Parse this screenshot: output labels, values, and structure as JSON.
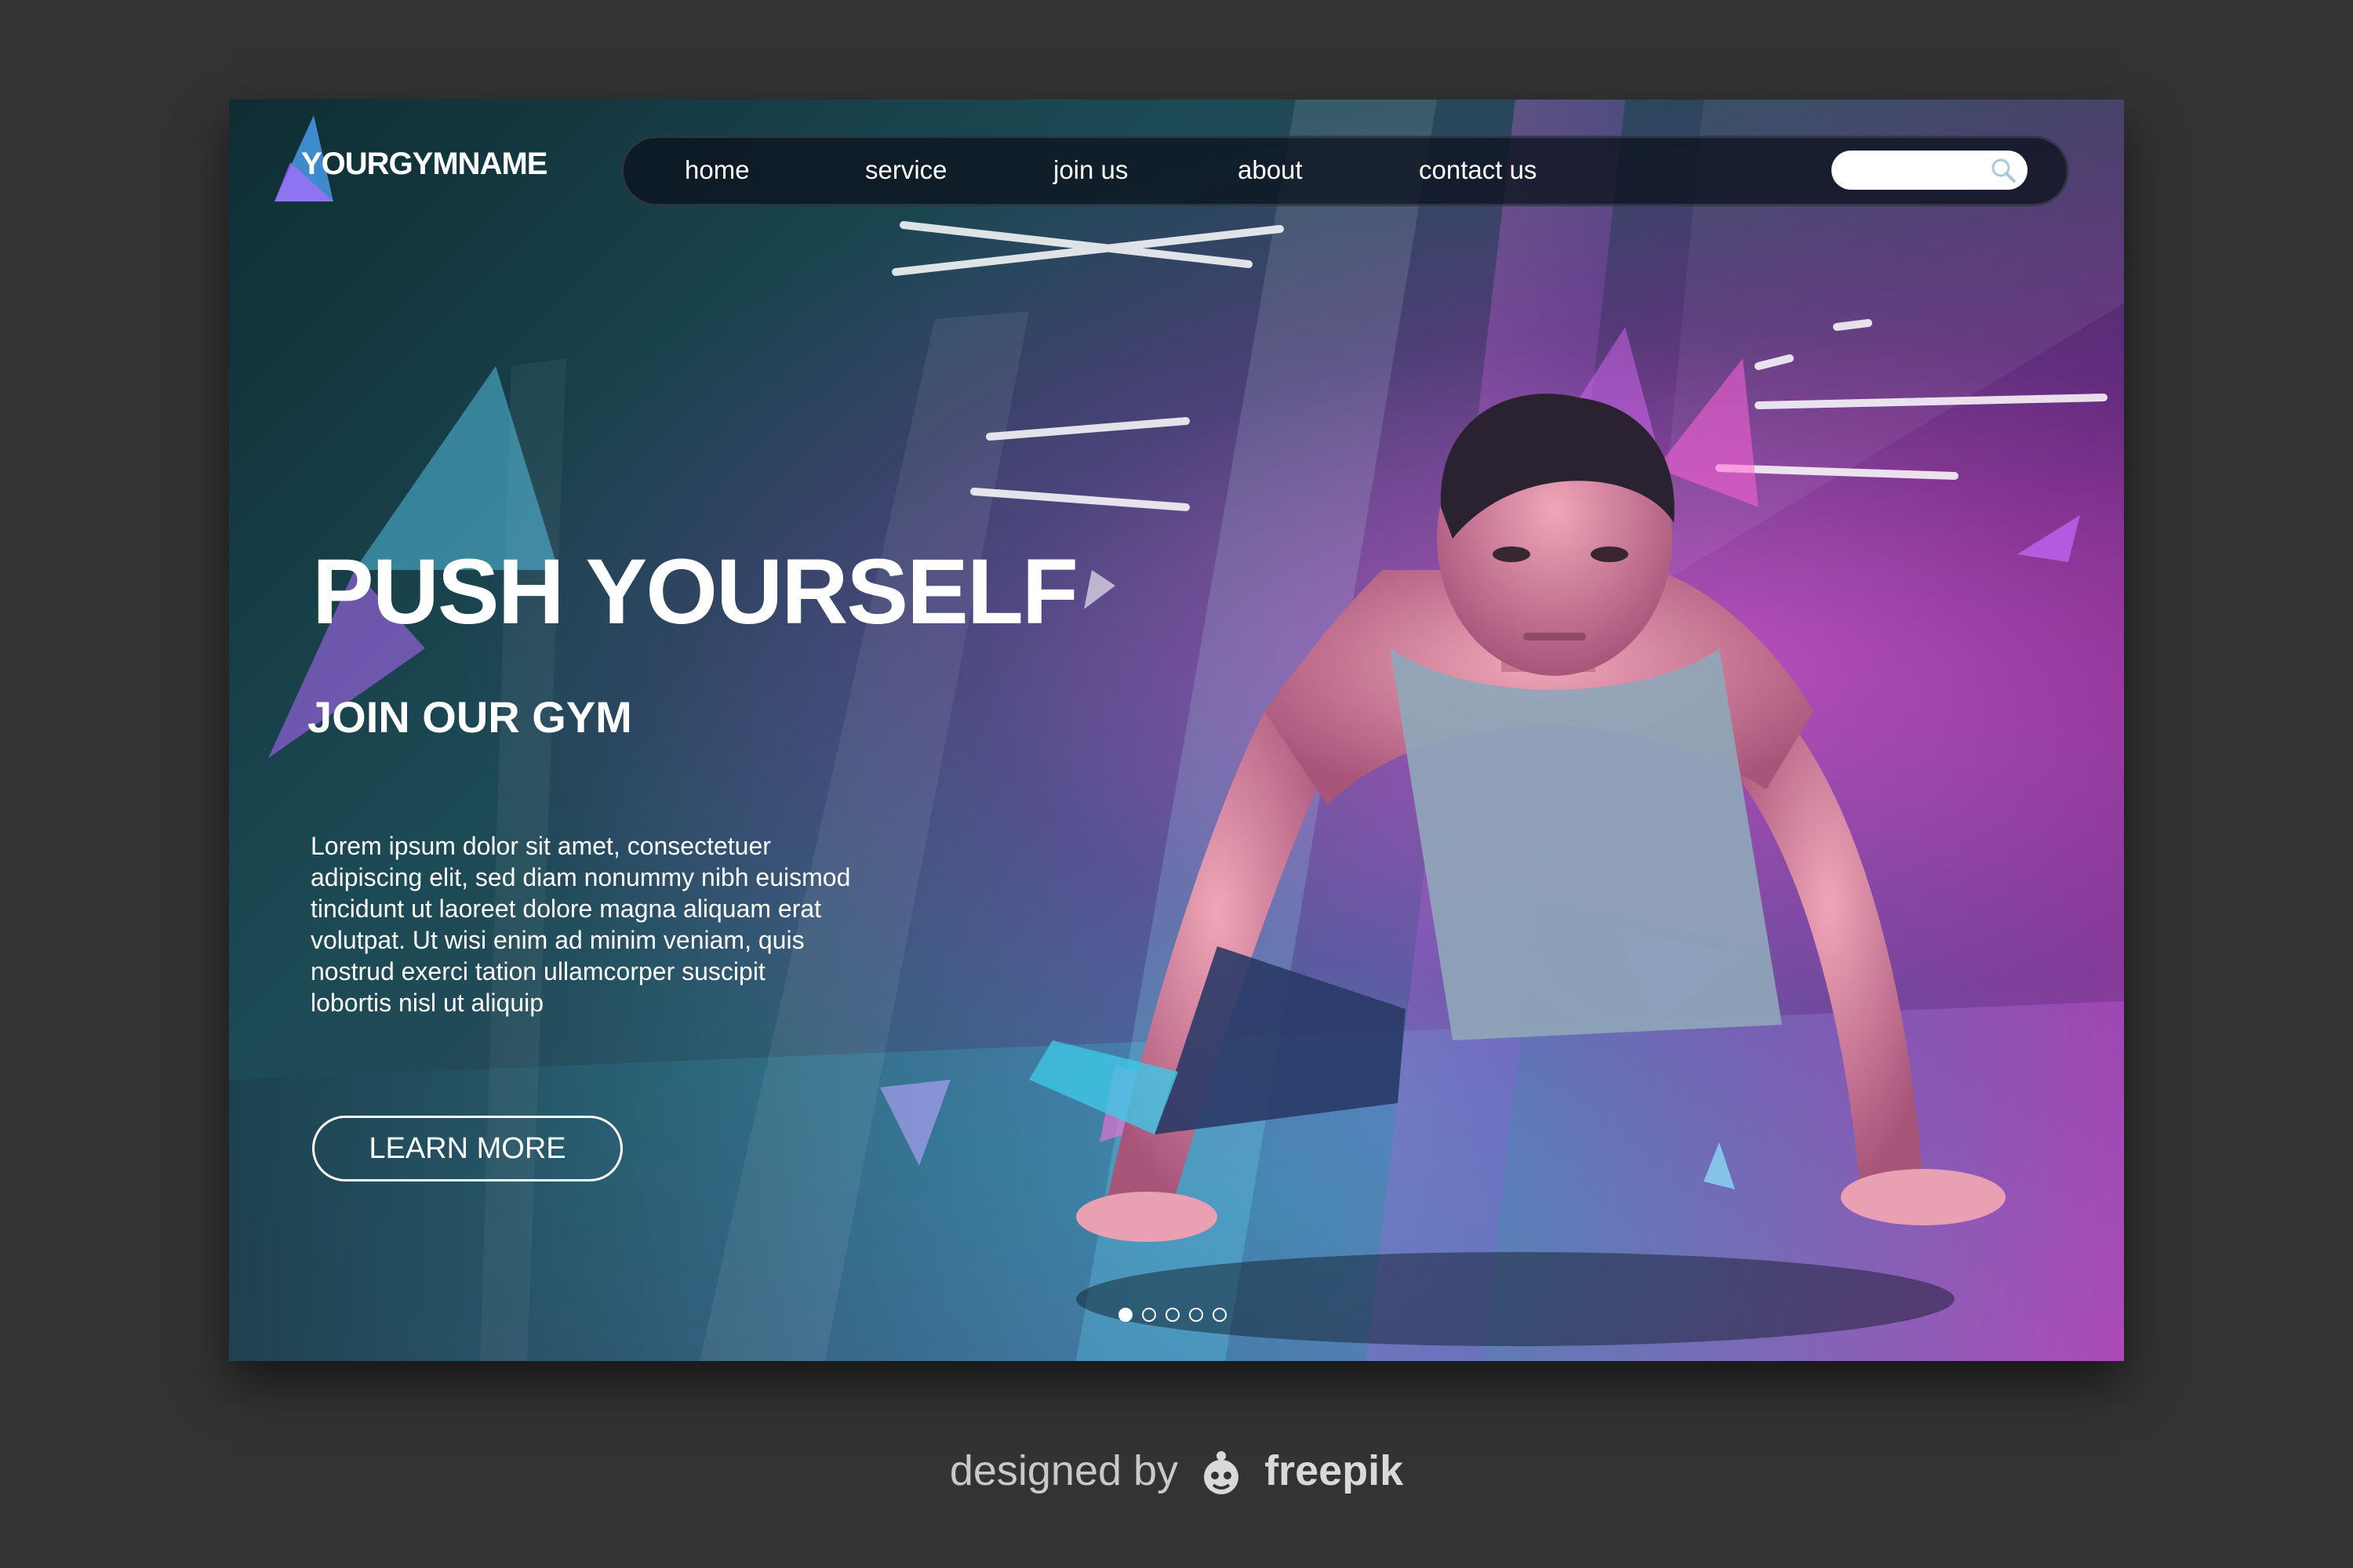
{
  "brand": {
    "logo_text": "YOURGYMNAME"
  },
  "nav": {
    "items": [
      {
        "label": "home"
      },
      {
        "label": "service"
      },
      {
        "label": "join us"
      },
      {
        "label": "about"
      },
      {
        "label": "contact us"
      }
    ],
    "search": {
      "placeholder": "",
      "icon": "search-icon"
    }
  },
  "hero": {
    "headline": "PUSH YOURSELF",
    "subheadline": "JOIN OUR GYM",
    "body": "Lorem ipsum dolor sit amet, consectetuer adipiscing elit, sed diam nonummy nibh euismod tincidunt ut laoreet dolore magna aliquam erat volutpat. Ut wisi enim ad minim veniam, quis nostrud exerci tation ullamcorper suscipit lobortis nisl ut aliquip",
    "cta_label": "LEARN MORE"
  },
  "carousel": {
    "slide_count": 5,
    "active_index": 1
  },
  "credit": {
    "prefix": "designed by",
    "brand": "freepik"
  },
  "colors": {
    "page_background": "#333333",
    "teal": "#1c4a55",
    "magenta": "#b0389f",
    "text": "#ffffff"
  }
}
